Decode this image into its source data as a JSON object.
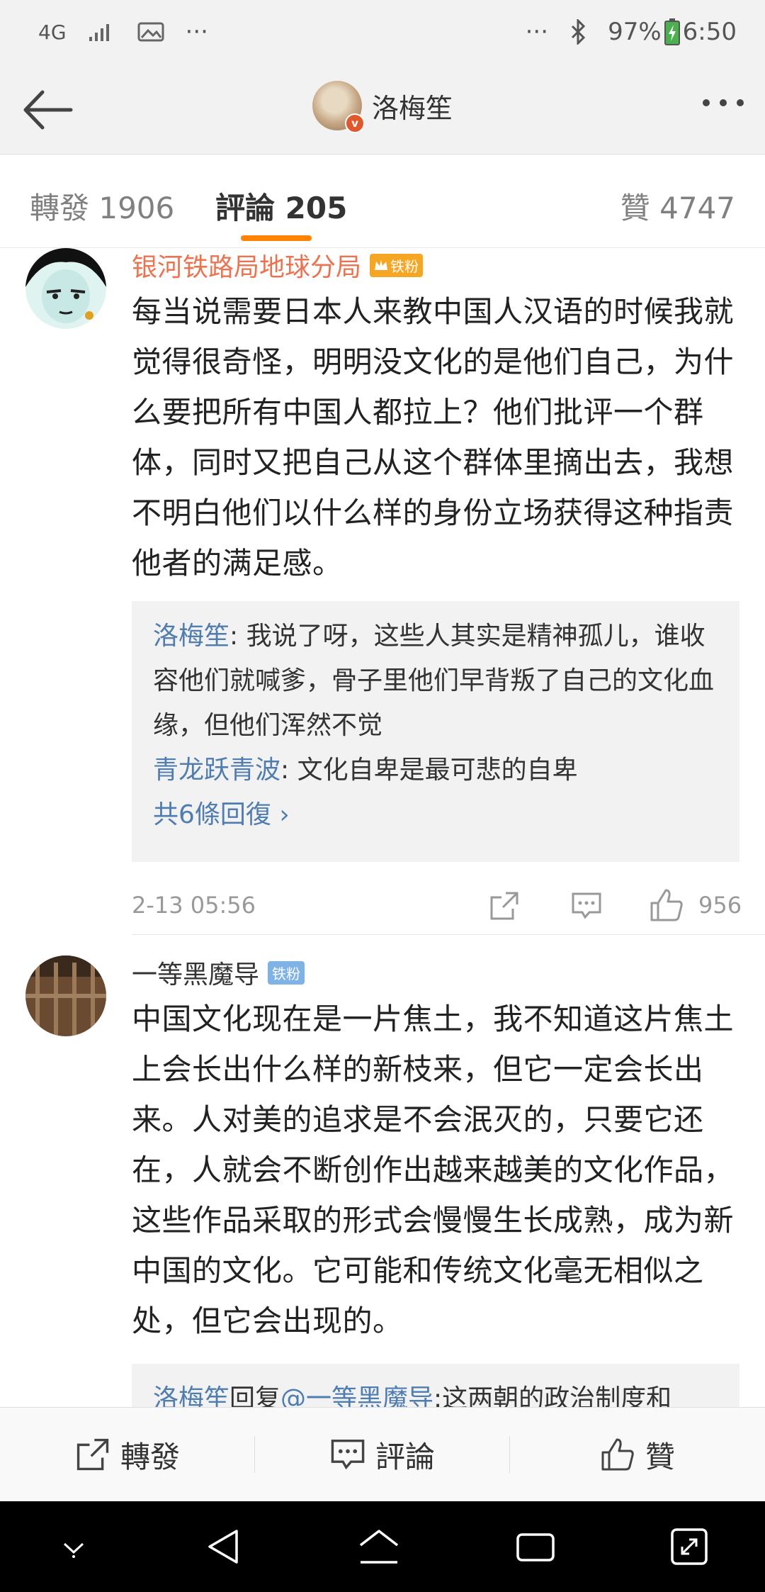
{
  "status_bar": {
    "network": "4G",
    "battery": "97%",
    "time": "6:50",
    "overflow_left": "···",
    "overflow_right": "···"
  },
  "header": {
    "username": "洛梅笙",
    "verified_mark": "v"
  },
  "tabs": {
    "repost": "轉發 1906",
    "comments": "評論 205",
    "likes": "贊 4747"
  },
  "comments": [
    {
      "author": "银河铁路局地球分局",
      "badge": "铁粉",
      "text": "每当说需要日本人来教中国人汉语的时候我就觉得很奇怪，明明没文化的是他们自己，为什么要把所有中国人都拉上？他们批评一个群体，同时又把自己从这个群体里摘出去，我想不明白他们以什么样的身份立场获得这种指责他者的满足感。",
      "replies": [
        {
          "name": "洛梅笙",
          "sep": ": ",
          "text": "我说了呀，这些人其实是精神孤儿，谁收容他们就喊爹，骨子里他们早背叛了自己的文化血缘，但他们浑然不觉"
        },
        {
          "name": "青龙跃青波",
          "sep": ": ",
          "text": "文化自卑是最可悲的自卑"
        }
      ],
      "more_replies": "共6條回復 ›",
      "time": "2-13 05:56",
      "like_count": "956"
    },
    {
      "author": "一等黑魔导",
      "badge": "铁粉",
      "text": "中国文化现在是一片焦土，我不知道这片焦土上会长出什么样的新枝来，但它一定会长出来。人对美的追求是不会泯灭的，只要它还在，人就会不断创作出越来越美的文化作品，这些作品采取的形式会慢慢生长成熟，成为新中国的文化。它可能和传统文化毫无相似之处，但它会出现的。",
      "partial_reply": {
        "name": "洛梅笙",
        "reply_word": "回复",
        "mention": "@一等黑魔导",
        "text": ":这两朝的政治制度和"
      }
    }
  ],
  "bottom_bar": {
    "repost": "轉發",
    "comment": "評論",
    "like": "贊"
  }
}
